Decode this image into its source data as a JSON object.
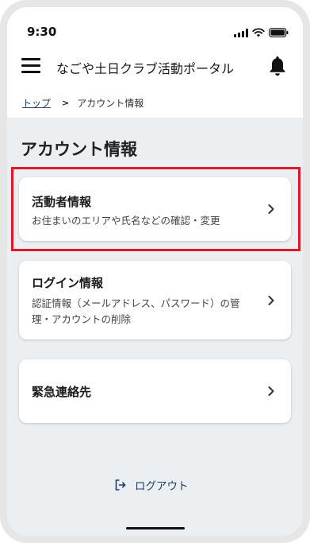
{
  "status_bar": {
    "time": "9:30"
  },
  "header": {
    "title": "なごや土日クラブ活動ポータル"
  },
  "breadcrumb": {
    "home": "トップ",
    "current": "アカウント情報"
  },
  "page": {
    "title": "アカウント情報"
  },
  "cards": [
    {
      "title": "活動者情報",
      "description": "お住まいのエリアや氏名などの確認・変更"
    },
    {
      "title": "ログイン情報",
      "description": "認証情報（メールアドレス、パスワード）の管理・アカウントの削除"
    },
    {
      "title": "緊急連絡先",
      "description": ""
    }
  ],
  "logout": {
    "label": "ログアウト"
  },
  "icons": {
    "menu": "hamburger-menu-icon",
    "notifications": "bell-icon",
    "chevron": "chevron-right-icon",
    "logout": "logout-icon"
  },
  "colors": {
    "highlight": "#e0182a",
    "link": "#1f3d66",
    "background": "#eceff1"
  }
}
